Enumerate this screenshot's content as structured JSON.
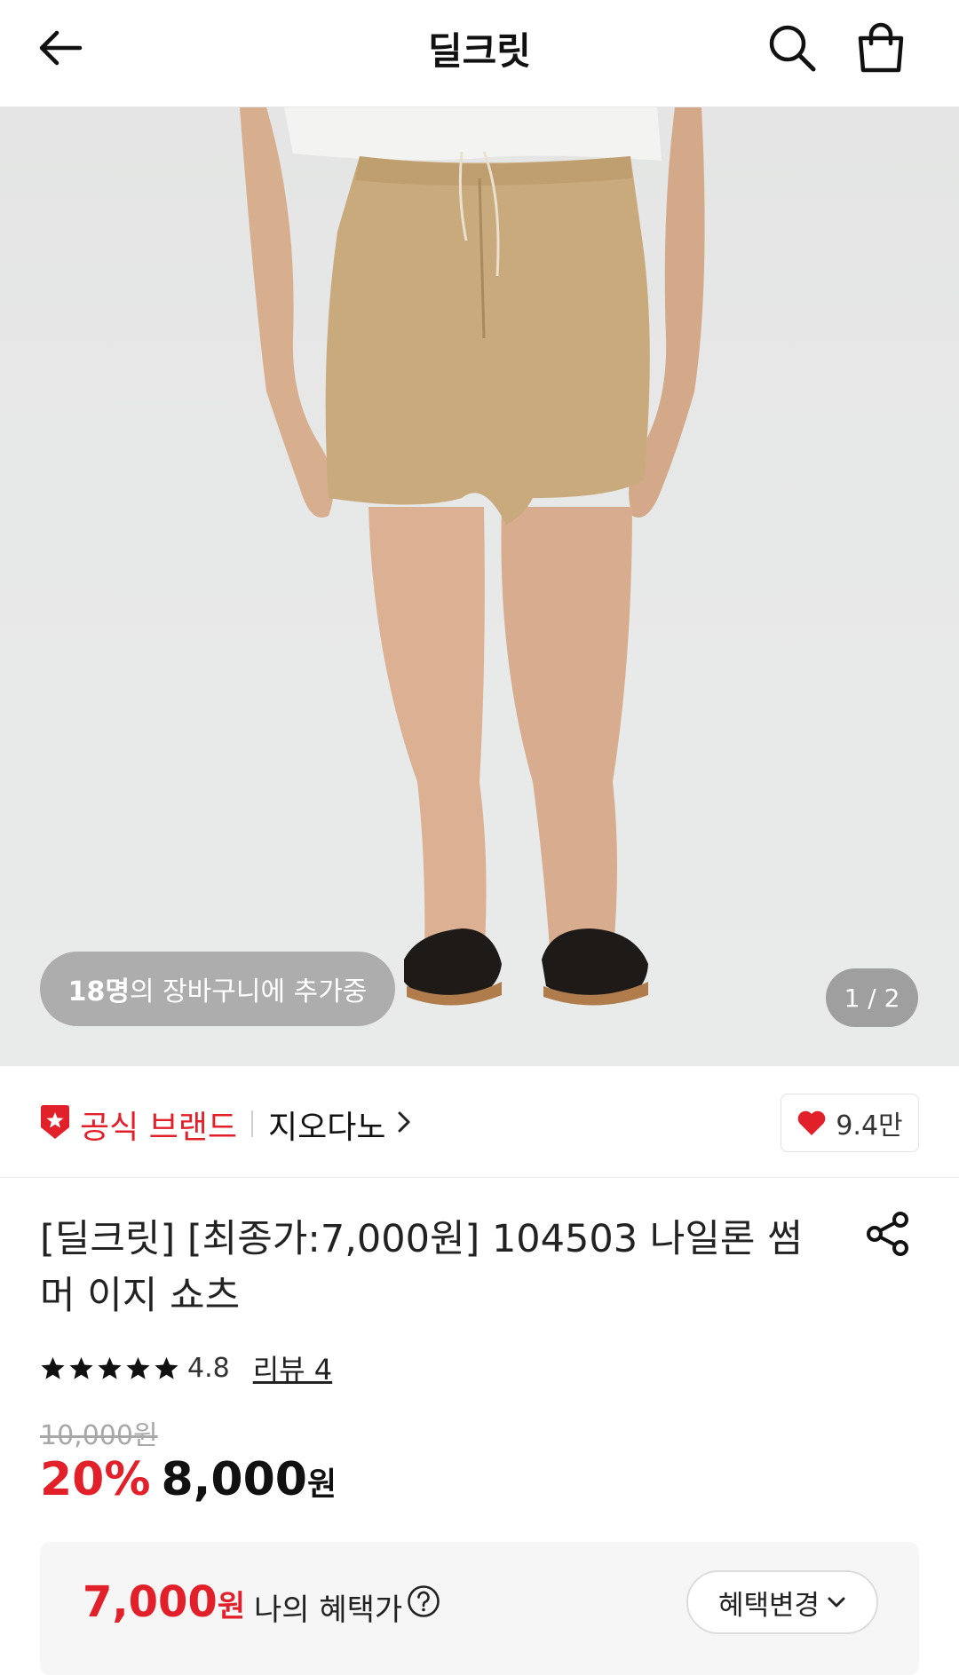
{
  "header": {
    "title": "딜크릿"
  },
  "hero": {
    "cart_count": "18명",
    "cart_suffix": "의 장바구니에 추가중",
    "page_counter": "1 / 2"
  },
  "brand": {
    "official_label": "공식 브랜드",
    "name": "지오다노",
    "likes": "9.4만"
  },
  "product": {
    "title_line1": "[딜크릿] [최종가:7,000원] 104503 나일론 썸",
    "title_line2": "머 이지 쇼츠",
    "rating": "4.8",
    "stars": 5,
    "review_link": "리뷰 4",
    "original_price": "10,000원",
    "discount": "20%",
    "sale_price": "8,000",
    "sale_unit": "원"
  },
  "benefit": {
    "price": "7,000",
    "unit": "원",
    "label": "나의 혜택가",
    "change_button": "혜택변경"
  },
  "colors": {
    "accent_red": "#e2202a",
    "heart": "#e2202a"
  }
}
